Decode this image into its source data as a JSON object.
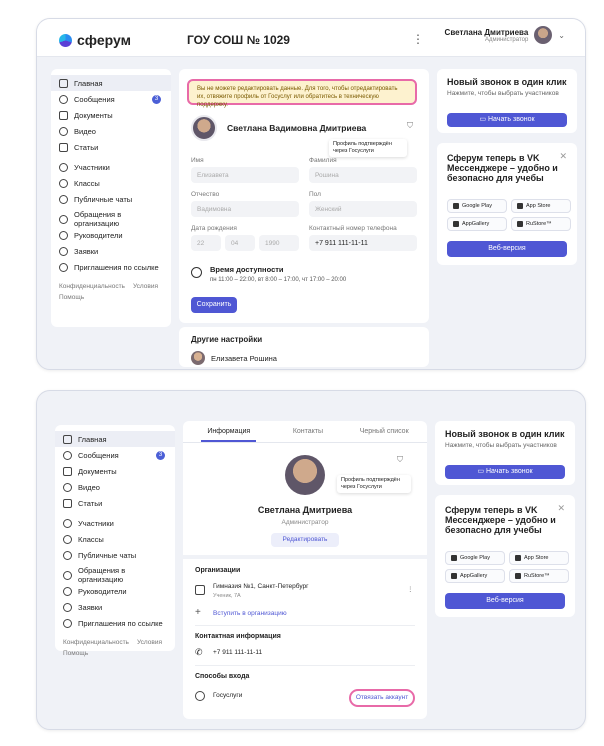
{
  "app": {
    "logo": "сферум",
    "school": "ГОУ СОШ № 1029",
    "kebab": "⋮"
  },
  "user": {
    "name": "Светлана Дмитриева",
    "role": "Администратор"
  },
  "nav": [
    {
      "label": "Главная",
      "icon": "grid-icon"
    },
    {
      "label": "Сообщения",
      "icon": "chat-icon",
      "badge": "3"
    },
    {
      "label": "Документы",
      "icon": "document-icon"
    },
    {
      "label": "Видео",
      "icon": "play-icon"
    },
    {
      "label": "Статьи",
      "icon": "article-icon"
    },
    {
      "label": "Участники",
      "icon": "users-icon"
    },
    {
      "label": "Классы",
      "icon": "classes-icon"
    },
    {
      "label": "Публичные чаты",
      "icon": "public-chat-icon"
    },
    {
      "label": "Обращения в организацию",
      "icon": "appeal-icon"
    },
    {
      "label": "Руководители",
      "icon": "manager-icon"
    },
    {
      "label": "Заявки",
      "icon": "request-icon"
    },
    {
      "label": "Приглашения по ссылке",
      "icon": "link-icon"
    }
  ],
  "sidefoot": {
    "privacy": "Конфиденциальность",
    "terms": "Условия",
    "help": "Помощь"
  },
  "screen1": {
    "warning": "Вы не можете редактировать данные. Для того, чтобы отредактировать их, отвяжите профиль от Госуслуг или обратитесь в техническую поддержку.",
    "full_name": "Светлана Вадимовна Дмитриева",
    "tooltip": "Профиль подтверждён через Госуслуги",
    "fields": {
      "first_name_label": "Имя",
      "first_name": "Елизавета",
      "last_name_label": "Фамилия",
      "last_name": "Рошина",
      "patronymic_label": "Отчество",
      "patronymic": "Вадимовна",
      "gender_label": "Пол",
      "gender": "Женский",
      "birth_label": "Дата рождения",
      "birth_d": "22",
      "birth_m": "04",
      "birth_y": "1990",
      "phone_label": "Контактный номер телефона",
      "phone": "+7 911 111-11-11"
    },
    "availability_title": "Время доступности",
    "availability_text": "пн 11:00 – 22:00, вт 8:00 – 17:00, чт 17:00 – 20:00",
    "save": "Сохранить",
    "other_settings": "Другие настройки",
    "other_user": "Елизавета Рошина"
  },
  "screen2": {
    "tabs": [
      "Информация",
      "Контакты",
      "Черный список"
    ],
    "tooltip": "Профиль подтверждён через Госуслуги",
    "name": "Светлана Дмитриева",
    "role": "Администратор",
    "edit": "Редактировать",
    "org_title": "Организации",
    "org_name": "Гимназия №1, Санкт-Петербург",
    "org_role": "Ученик, 7А",
    "join_org": "Вступить в организацию",
    "contact_title": "Контактная информация",
    "phone": "+7 911 111-11-11",
    "login_title": "Способы входа",
    "gosuslugi": "Госуслуги",
    "unlink": "Отвязать аккаунт"
  },
  "right": {
    "call_title": "Новый звонок в один клик",
    "call_sub": "Нажмите, чтобы выбрать участников",
    "call_btn": "Начать звонок",
    "promo_title": "Сферум теперь в VK Мессенджере – удобно и безопасно для учебы",
    "stores": [
      "Google Play",
      "App Store",
      "AppGallery",
      "RuStore™"
    ],
    "web": "Веб-версия"
  },
  "colors": {
    "accent": "#4f57d4",
    "highlight": "#e86aa8",
    "warn_bg": "#fdf2cf"
  }
}
